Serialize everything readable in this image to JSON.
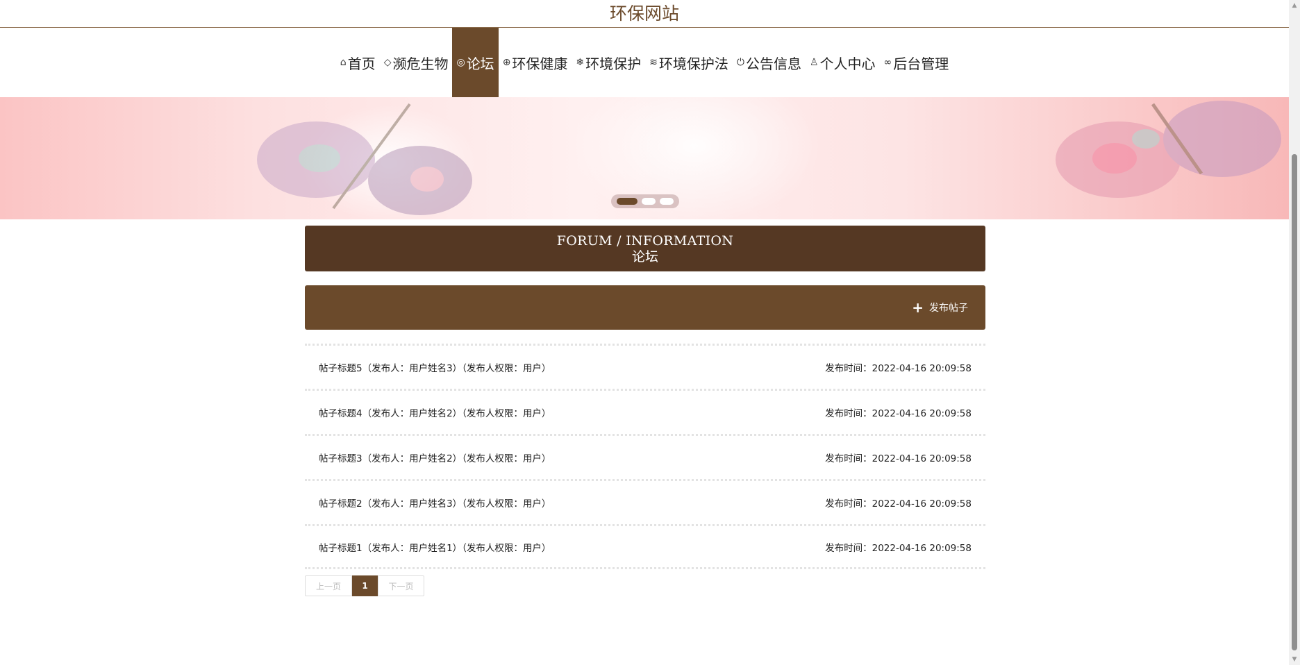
{
  "header": {
    "title": "环保网站"
  },
  "nav": {
    "items": [
      {
        "label": "首页",
        "icon": "home-icon",
        "glyph": "⌂"
      },
      {
        "label": "濒危生物",
        "icon": "tag-icon",
        "glyph": "◇"
      },
      {
        "label": "论坛",
        "icon": "palette-icon",
        "glyph": "◎",
        "active": true
      },
      {
        "label": "环保健康",
        "icon": "globe-icon",
        "glyph": "⊕"
      },
      {
        "label": "环境保护",
        "icon": "snowflake-icon",
        "glyph": "❄"
      },
      {
        "label": "环境保护法",
        "icon": "layers-icon",
        "glyph": "≋"
      },
      {
        "label": "公告信息",
        "icon": "power-icon",
        "glyph": "⏻"
      },
      {
        "label": "个人中心",
        "icon": "user-icon",
        "glyph": "♙"
      },
      {
        "label": "后台管理",
        "icon": "link-icon",
        "glyph": "∞"
      }
    ]
  },
  "banner": {
    "slide_count": 3,
    "active_slide": 1
  },
  "section": {
    "title_en": "FORUM / INFORMATION",
    "title_cn": "论坛"
  },
  "actions": {
    "post_label": "发布帖子",
    "post_icon": "plus-icon"
  },
  "posts": [
    {
      "title": "帖子标题5（发布人：用户姓名3）（发布人权限：用户）",
      "time": "发布时间：2022-04-16 20:09:58"
    },
    {
      "title": "帖子标题4（发布人：用户姓名2）（发布人权限：用户）",
      "time": "发布时间：2022-04-16 20:09:58"
    },
    {
      "title": "帖子标题3（发布人：用户姓名2）（发布人权限：用户）",
      "time": "发布时间：2022-04-16 20:09:58"
    },
    {
      "title": "帖子标题2（发布人：用户姓名3）（发布人权限：用户）",
      "time": "发布时间：2022-04-16 20:09:58"
    },
    {
      "title": "帖子标题1（发布人：用户姓名1）（发布人权限：用户）",
      "time": "发布时间：2022-04-16 20:09:58"
    }
  ],
  "pager": {
    "prev": "上一页",
    "current": "1",
    "next": "下一页"
  },
  "colors": {
    "brand": "#6b4a2b",
    "title_bar": "#553823",
    "banner": "#fde0e0"
  }
}
